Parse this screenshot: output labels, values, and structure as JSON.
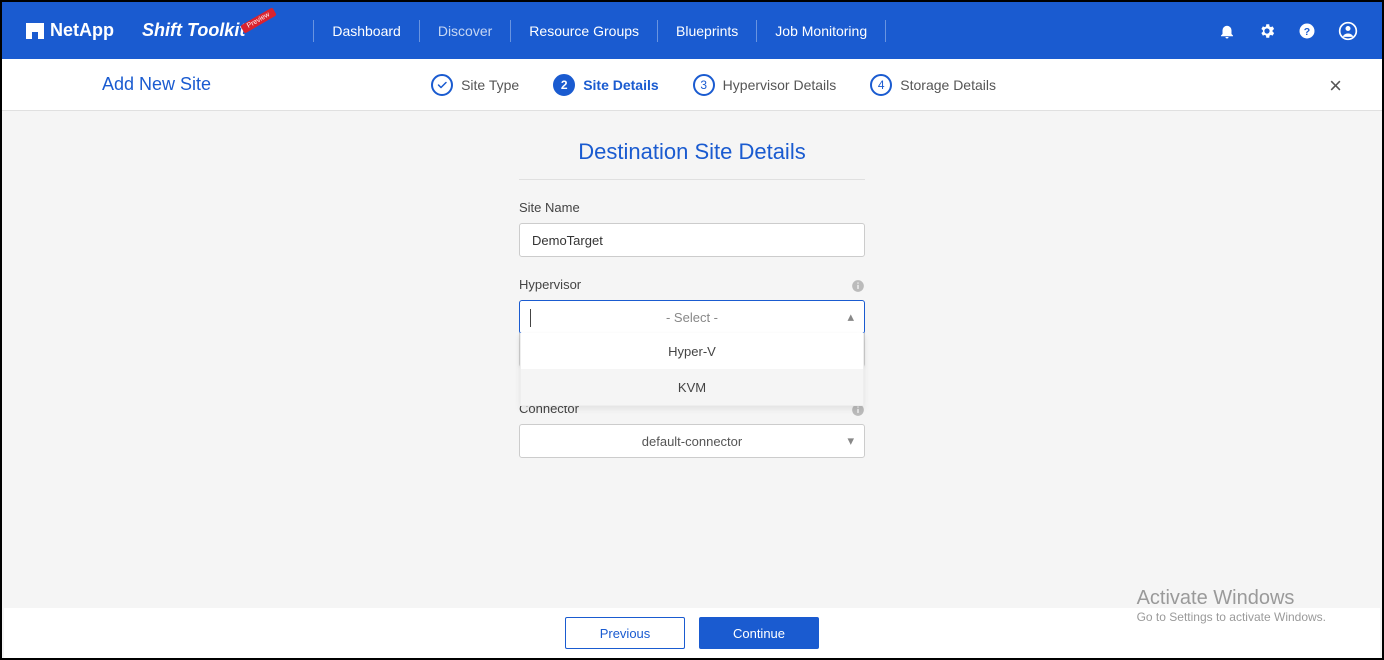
{
  "header": {
    "brand": "NetApp",
    "product": "Shift Toolkit",
    "badge": "Preview",
    "nav": {
      "dashboard": "Dashboard",
      "discover": "Discover",
      "resource_groups": "Resource Groups",
      "blueprints": "Blueprints",
      "job_monitoring": "Job Monitoring"
    }
  },
  "subheader": {
    "title": "Add New Site",
    "steps": {
      "s1": {
        "num": "✓",
        "label": "Site Type"
      },
      "s2": {
        "num": "2",
        "label": "Site Details"
      },
      "s3": {
        "num": "3",
        "label": "Hypervisor Details"
      },
      "s4": {
        "num": "4",
        "label": "Storage Details"
      }
    }
  },
  "form": {
    "title": "Destination Site Details",
    "site_name": {
      "label": "Site Name",
      "value": "DemoTarget"
    },
    "hypervisor": {
      "label": "Hypervisor",
      "placeholder": "- Select -",
      "options": {
        "o1": "Hyper-V",
        "o2": "KVM"
      }
    },
    "connector": {
      "label": "Connector",
      "value": "default-connector"
    }
  },
  "footer": {
    "prev": "Previous",
    "cont": "Continue"
  },
  "watermark": {
    "line1": "Activate Windows",
    "line2": "Go to Settings to activate Windows."
  }
}
